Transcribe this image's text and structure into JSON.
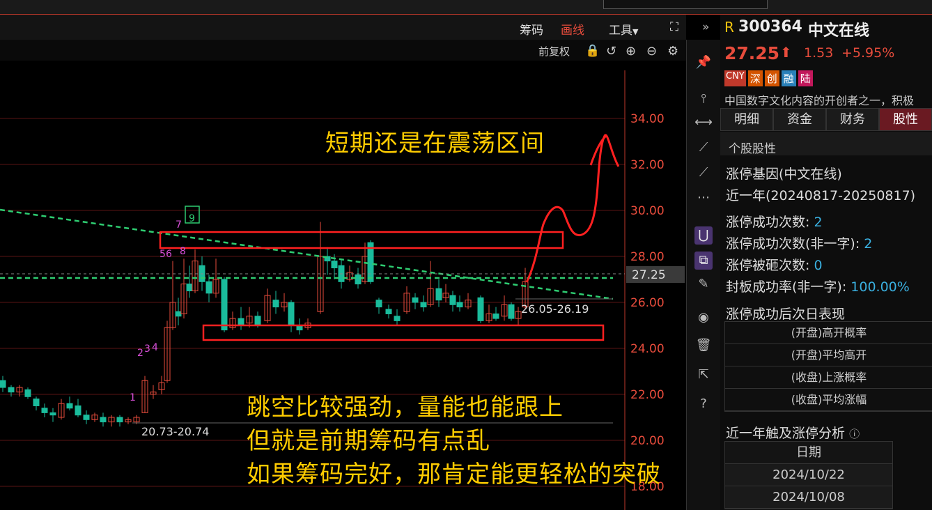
{
  "toolbar": {
    "chouma": "筹码",
    "huaxian": "画线",
    "gongju": "工具",
    "qianfuquan": "前复权"
  },
  "stock": {
    "prefix": "R",
    "code": "300364",
    "name": "中文在线",
    "price": "27.25",
    "change": "1.53",
    "change_pct": "+5.95%",
    "badges": [
      "CNY",
      "深",
      "创",
      "融",
      "陆"
    ],
    "desc": "中国数字文化内容的开创者之一，积极"
  },
  "tabs": [
    "明细",
    "资金",
    "财务",
    "股性"
  ],
  "panel": {
    "section": "个股股性",
    "gene_title": "涨停基因(中文在线)",
    "period": "近一年(20240817-20250817)",
    "stats": [
      {
        "label": "涨停成功次数:",
        "value": "2"
      },
      {
        "label": "涨停成功次数(非一字):",
        "value": "2"
      },
      {
        "label": "涨停被砸次数:",
        "value": "0"
      },
      {
        "label": "封板成功率(非一字):",
        "value": "100.00%"
      }
    ],
    "next_day_title": "涨停成功后次日表现",
    "next_day_rows": [
      "(开盘)高开概率",
      "(开盘)平均高开",
      "(收盘)上涨概率",
      "(收盘)平均涨幅"
    ],
    "analysis_title": "近一年触及涨停分析",
    "date_header": "日期",
    "dates": [
      "2024/10/22",
      "2024/10/08"
    ]
  },
  "axis": {
    "labels": [
      "34.00",
      "32.00",
      "30.00",
      "28.00",
      "26.00",
      "24.00",
      "22.00",
      "20.00",
      "18.00"
    ],
    "current": "27.25"
  },
  "chart_labels": {
    "range_high": "26.05-26.19",
    "range_low": "20.73-20.74",
    "seq": [
      "1",
      "2",
      "3",
      "4",
      "5",
      "6",
      "7",
      "8",
      "9"
    ]
  },
  "annotations": {
    "top": "短期还是在震荡区间",
    "line1": "跳空比较强劲，量能也能跟上",
    "line2": "但就是前期筹码有点乱",
    "line3": "如果筹码完好，那肯定能更轻松的突破"
  },
  "colors": {
    "up": "#e74c3c",
    "down": "#1abc9c",
    "accent": "#ffcc00",
    "trend": "#2ecc71"
  }
}
